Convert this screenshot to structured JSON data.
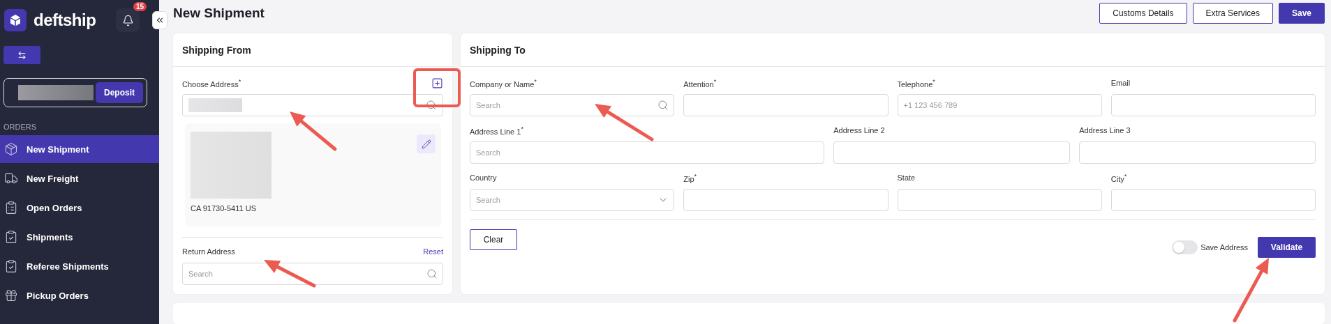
{
  "sidebar": {
    "brand": "deftship",
    "notification_count": "15",
    "deposit_button": "Deposit",
    "section": "ORDERS",
    "items": [
      {
        "label": "New Shipment",
        "selected": true
      },
      {
        "label": "New Freight",
        "selected": false
      },
      {
        "label": "Open Orders",
        "selected": false
      },
      {
        "label": "Shipments",
        "selected": false
      },
      {
        "label": "Referee Shipments",
        "selected": false
      },
      {
        "label": "Pickup Orders",
        "selected": false
      }
    ]
  },
  "header": {
    "title": "New Shipment",
    "buttons": [
      {
        "label": "Customs Details",
        "kind": "outline"
      },
      {
        "label": "Extra Services",
        "kind": "outline"
      },
      {
        "label": "Save",
        "kind": "primary"
      }
    ]
  },
  "shipping_from": {
    "title": "Shipping From",
    "choose_address": {
      "label": "Choose Address$^{*}$"
    },
    "address_card": {
      "last_line": "CA 91730-5411 US"
    },
    "return_address": {
      "label": "Return Address",
      "reset": "Reset",
      "placeholder": "Search"
    }
  },
  "shipping_to": {
    "title": "Shipping To",
    "rows": [
      {
        "fields": [
          {
            "label": "Company or Name$^{*}$",
            "kind": "search",
            "placeholder": "Search"
          },
          {
            "label": "Attention$^{*}$",
            "kind": "text"
          },
          {
            "label": "Telephone$^{*}$",
            "kind": "text",
            "placeholder": "+1 123 456 789"
          },
          {
            "label": "Email",
            "kind": "text"
          }
        ]
      },
      {
        "fields": [
          {
            "label": "Address Line 1$^{*}$",
            "kind": "text",
            "placeholder": "Search"
          },
          {
            "label": "Address Line 2",
            "kind": "text"
          },
          {
            "label": "Address Line 3",
            "kind": "text"
          }
        ]
      },
      {
        "fields": [
          {
            "label": "Country",
            "kind": "select",
            "placeholder": "Search"
          },
          {
            "label": "Zip$^{*}$",
            "kind": "text"
          },
          {
            "label": "State",
            "kind": "text"
          },
          {
            "label": "City$^{*}$",
            "kind": "text"
          }
        ]
      }
    ],
    "clear_button": "Clear",
    "save_address": {
      "label": "Save Address",
      "on": false
    },
    "validate_button": "Validate"
  }
}
